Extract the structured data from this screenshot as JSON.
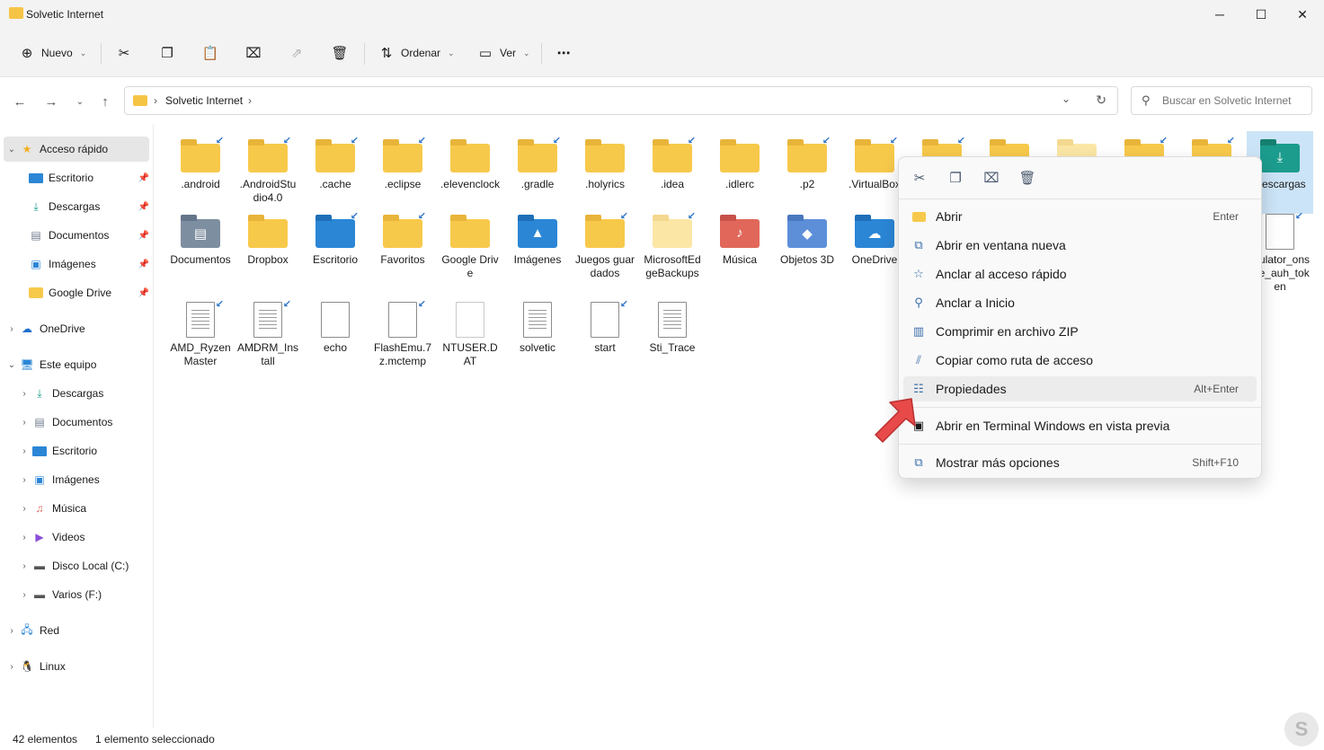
{
  "window": {
    "title": "Solvetic Internet"
  },
  "toolbar": {
    "new_label": "Nuevo",
    "sort_label": "Ordenar",
    "view_label": "Ver"
  },
  "address": {
    "crumb": "Solvetic Internet",
    "search_placeholder": "Buscar en Solvetic Internet"
  },
  "sidebar": {
    "quick_access": "Acceso rápido",
    "items": [
      {
        "label": "Escritorio",
        "icon": "desktop-icon"
      },
      {
        "label": "Descargas",
        "icon": "download-icon"
      },
      {
        "label": "Documentos",
        "icon": "document-icon"
      },
      {
        "label": "Imágenes",
        "icon": "image-icon"
      },
      {
        "label": "Google Drive",
        "icon": "folder-icon"
      },
      {
        "label": "OneDrive",
        "icon": "cloud-icon"
      },
      {
        "label": "Este equipo",
        "icon": "computer-icon"
      },
      {
        "label": "Descargas",
        "icon": "download-icon"
      },
      {
        "label": "Documentos",
        "icon": "document-icon"
      },
      {
        "label": "Escritorio",
        "icon": "desktop-icon"
      },
      {
        "label": "Imágenes",
        "icon": "image-icon"
      },
      {
        "label": "Música",
        "icon": "music-icon"
      },
      {
        "label": "Videos",
        "icon": "video-icon"
      },
      {
        "label": "Disco Local (C:)",
        "icon": "drive-icon"
      },
      {
        "label": "Varios (F:)",
        "icon": "usb-drive-icon"
      },
      {
        "label": "Red",
        "icon": "network-icon"
      },
      {
        "label": "Linux",
        "icon": "linux-icon"
      }
    ]
  },
  "files": [
    {
      "name": ".android"
    },
    {
      "name": ".AndroidStudio4.0"
    },
    {
      "name": ".cache"
    },
    {
      "name": ".eclipse"
    },
    {
      "name": ".elevenclock"
    },
    {
      "name": ".gradle"
    },
    {
      "name": ".holyrics"
    },
    {
      "name": ".idea"
    },
    {
      "name": ".idlerc"
    },
    {
      "name": ".p2"
    },
    {
      "name": ".VirtualBox"
    },
    {
      "name": "Descargas"
    },
    {
      "name": "Documentos"
    },
    {
      "name": "Dropbox"
    },
    {
      "name": "Escritorio"
    },
    {
      "name": "Favoritos"
    },
    {
      "name": "Google Drive"
    },
    {
      "name": "Imágenes"
    },
    {
      "name": "Juegos guardados"
    },
    {
      "name": "MicrosoftEdgeBackups"
    },
    {
      "name": "Música"
    },
    {
      "name": "Objetos 3D"
    },
    {
      "name": "OneDrive"
    },
    {
      "name": "mulator_onsole_auh_token"
    },
    {
      "name": "AMD_RyzenMaster"
    },
    {
      "name": "AMDRM_Install"
    },
    {
      "name": "echo"
    },
    {
      "name": "FlashEmu.7z.mctemp"
    },
    {
      "name": "NTUSER.DAT"
    },
    {
      "name": "solvetic"
    },
    {
      "name": "start"
    },
    {
      "name": "Sti_Trace"
    }
  ],
  "context_menu": {
    "items": [
      {
        "label": "Abrir",
        "accel": "Enter"
      },
      {
        "label": "Abrir en ventana nueva",
        "accel": ""
      },
      {
        "label": "Anclar al acceso rápido",
        "accel": ""
      },
      {
        "label": "Anclar a Inicio",
        "accel": ""
      },
      {
        "label": "Comprimir en archivo ZIP",
        "accel": ""
      },
      {
        "label": "Copiar como ruta de acceso",
        "accel": ""
      },
      {
        "label": "Propiedades",
        "accel": "Alt+Enter"
      },
      {
        "label": "Abrir en Terminal Windows en vista previa",
        "accel": ""
      },
      {
        "label": "Mostrar más opciones",
        "accel": "Shift+F10"
      }
    ]
  },
  "status": {
    "count": "42 elementos",
    "selection": "1 elemento seleccionado"
  },
  "colors": {
    "folder": "#f7c94b",
    "selection": "#cce4f7",
    "accent": "#2b86d6",
    "pointer": "#e84a4a"
  }
}
